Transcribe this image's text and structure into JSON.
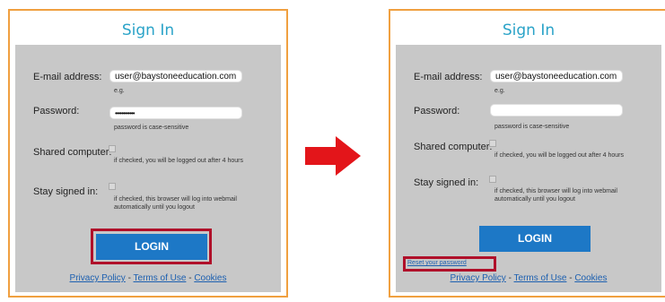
{
  "left": {
    "title": "Sign In",
    "email_label": "E-mail address:",
    "email_value": "user@baystoneeducation.com",
    "email_hint": "e.g.",
    "password_label": "Password:",
    "password_value": "••••••••••••",
    "password_hint": "password is case-sensitive",
    "shared_label": "Shared computer:",
    "shared_hint": "if checked, you will be logged out after 4 hours",
    "stay_label": "Stay signed in:",
    "stay_hint": "if checked, this browser will log into webmail automatically until you logout",
    "login_label": "LOGIN",
    "privacy": "Privacy Policy",
    "sep1": " - ",
    "terms": "Terms of Use",
    "sep2": " - ",
    "cookies": "Cookies"
  },
  "right": {
    "title": "Sign In",
    "email_label": "E-mail address:",
    "email_value": "user@baystoneeducation.com",
    "email_hint": "e.g.",
    "password_label": "Password:",
    "password_value": "",
    "password_hint": "password is case-sensitive",
    "shared_label": "Shared computer:",
    "shared_hint": "if checked, you will be logged out after 4 hours",
    "stay_label": "Stay signed in:",
    "stay_hint": "if checked, this browser will log into webmail automatically until you logout",
    "login_label": "LOGIN",
    "reset_label": "Reset your password",
    "privacy": "Privacy Policy",
    "sep1": " - ",
    "terms": "Terms of Use",
    "sep2": " - ",
    "cookies": "Cookies"
  },
  "colors": {
    "accent_title": "#2aa3c8",
    "panel_border": "#f0a040",
    "login_button": "#1d78c6",
    "highlight": "#b0102a",
    "arrow": "#e3151a"
  },
  "icons": {
    "arrow": "right-arrow-icon"
  }
}
